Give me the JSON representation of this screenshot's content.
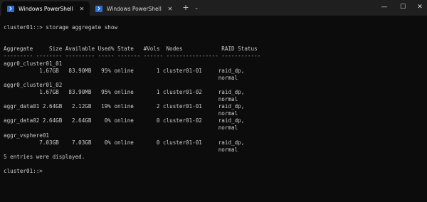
{
  "tabs": [
    {
      "title": "Windows PowerShell",
      "active": true
    },
    {
      "title": "Windows PowerShell",
      "active": false
    }
  ],
  "titlebar": {
    "new_tab_glyph": "+",
    "dropdown_glyph": "⌄",
    "minimize_glyph": "—",
    "maximize_glyph": "☐",
    "close_glyph": "✕"
  },
  "terminal": {
    "lines": [
      "",
      "cluster01::> storage aggregate show",
      "",
      "",
      "Aggregate     Size Available Used% State   #Vols  Nodes            RAID Status",
      "--------- -------- --------- ----- ------- ------ ---------------- ------------",
      "aggr0_cluster01_01",
      "           1.67GB   83.90MB   95% online       1 cluster01-01     raid_dp,",
      "                                                                  normal",
      "aggr0_cluster01_02",
      "           1.67GB   83.90MB   95% online       1 cluster01-02     raid_dp,",
      "                                                                  normal",
      "aggr_data01 2.64GB   2.12GB   19% online       2 cluster01-01     raid_dp,",
      "                                                                  normal",
      "aggr_data02 2.64GB   2.64GB    0% online       0 cluster01-02     raid_dp,",
      "                                                                  normal",
      "aggr_vsphere01",
      "           7.03GB    7.03GB    0% online       0 cluster01-01     raid_dp,",
      "                                                                  normal",
      "5 entries were displayed.",
      "",
      "cluster01::> ",
      "",
      "",
      ""
    ]
  }
}
